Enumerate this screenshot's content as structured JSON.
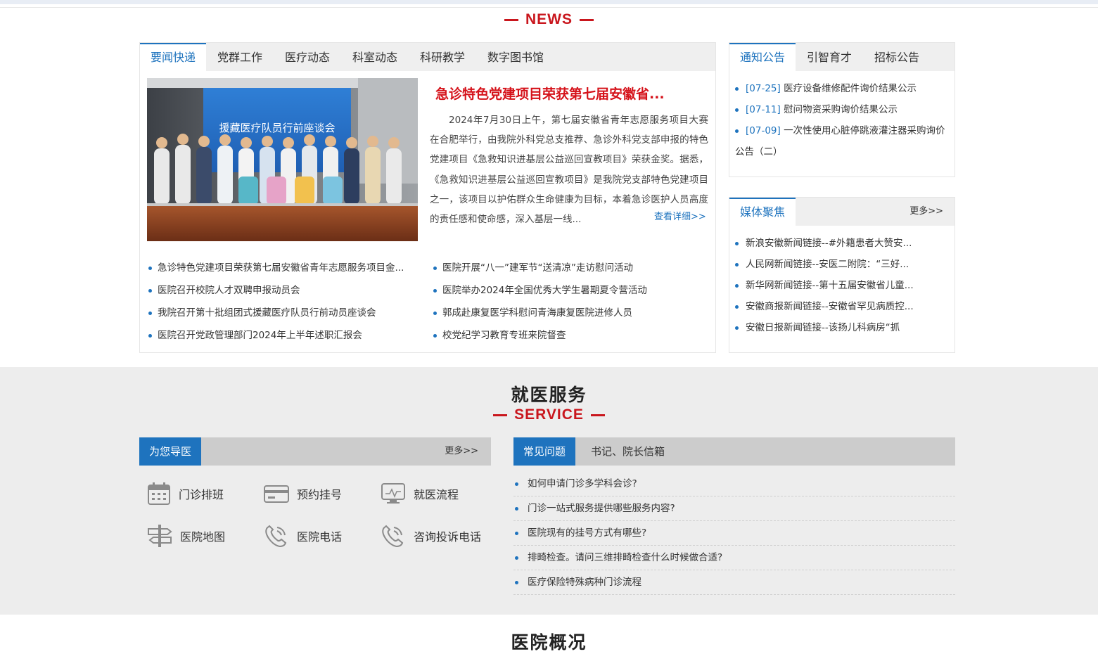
{
  "news_section": {
    "en_title": "NEWS",
    "tabs": [
      "要闻快递",
      "党群工作",
      "医疗动态",
      "科室动态",
      "科研教学",
      "数字图书馆"
    ],
    "feature": {
      "image_banner": "援藏医疗队员行前座谈会",
      "headline": "急诊特色党建项目荣获第七届安徽省...",
      "summary": "2024年7月30日上午，第七届安徽省青年志愿服务项目大赛在合肥举行，由我院外科党总支推荐、急诊外科党支部申报的特色党建项目《急救知识进基层公益巡回宣教项目》荣获金奖。据悉，《急救知识进基层公益巡回宣教项目》是我院党支部特色党建项目之一，该项目以护佑群众生命健康为目标，本着急诊医护人员高度的责任感和使命感，深入基层一线...",
      "more": "查看详细>>"
    },
    "list_left": [
      "急诊特色党建项目荣获第七届安徽省青年志愿服务项目金...",
      "医院召开校院人才双聘申报动员会",
      "我院召开第十批组团式援藏医疗队员行前动员座谈会",
      "医院召开党政管理部门2024年上半年述职汇报会"
    ],
    "list_right": [
      "医院开展“八一”建军节“送清凉”走访慰问活动",
      "医院举办2024年全国优秀大学生暑期夏令营活动",
      "郭成赴康复医学科慰问青海康复医院进修人员",
      "校党纪学习教育专班来院督查"
    ]
  },
  "notice_panel": {
    "tabs": [
      "通知公告",
      "引智育才",
      "招标公告"
    ],
    "items": [
      {
        "date": "[07-25]",
        "title": "医疗设备维修配件询价结果公示"
      },
      {
        "date": "[07-11]",
        "title": "慰问物资采购询价结果公示"
      },
      {
        "date": "[07-09]",
        "title": "一次性使用心脏停跳液灌注器采购询价公告（二）"
      }
    ]
  },
  "media_panel": {
    "tab": "媒体聚焦",
    "more": "更多>>",
    "items": [
      "新浪安徽新闻链接--#外籍患者大赞安...",
      "人民网新闻链接--安医二附院：“三好...",
      "新华网新闻链接--第十五届安徽省儿童...",
      "安徽商报新闻链接--安徽省罕见病质控...",
      "安徽日报新闻链接--该扬儿科病房“抓"
    ]
  },
  "service_section": {
    "cn_title": "就医服务",
    "en_title": "SERVICE",
    "guide": {
      "tab": "为您导医",
      "more": "更多>>",
      "items": [
        {
          "label": "门诊排班",
          "icon": "calendar-icon"
        },
        {
          "label": "预约挂号",
          "icon": "card-icon"
        },
        {
          "label": "就医流程",
          "icon": "monitor-icon"
        },
        {
          "label": "医院地图",
          "icon": "signpost-icon"
        },
        {
          "label": "医院电话",
          "icon": "phone-icon"
        },
        {
          "label": "咨询投诉电话",
          "icon": "phone-icon"
        }
      ]
    },
    "faq": {
      "tabs": [
        "常见问题",
        "书记、院长信箱"
      ],
      "items": [
        "如何申请门诊多学科会诊?",
        "门诊一站式服务提供哪些服务内容?",
        "医院现有的挂号方式有哪些?",
        "排畸检查。请问三维排畸检查什么时候做合适?",
        "医疗保险特殊病种门诊流程"
      ]
    }
  },
  "overview_section": {
    "cn_title": "医院概况"
  }
}
